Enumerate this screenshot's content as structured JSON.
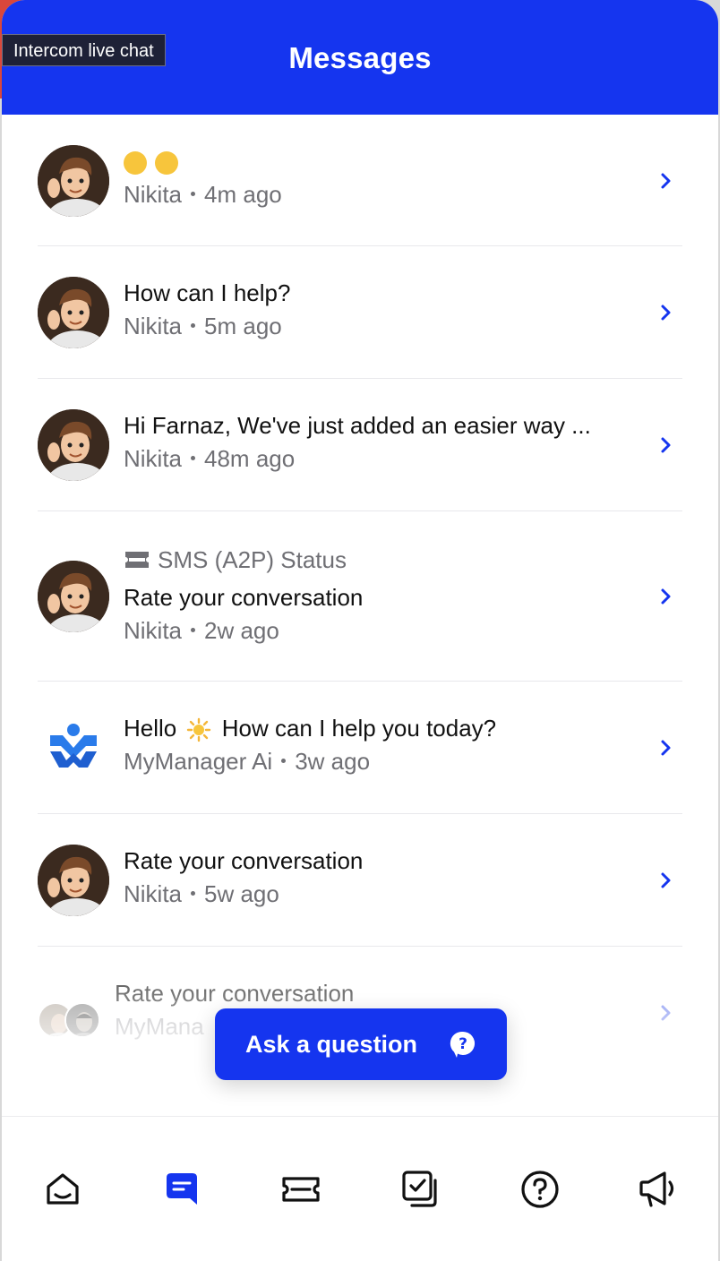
{
  "tooltip": "Intercom live chat",
  "header": {
    "title": "Messages"
  },
  "conversations": [
    {
      "title": "",
      "author": "Nikita",
      "time": "4m ago",
      "avatar": "nikita"
    },
    {
      "title": "How can I help?",
      "author": "Nikita",
      "time": "5m ago",
      "avatar": "nikita"
    },
    {
      "title": "Hi Farnaz, We've just added an easier way ...",
      "author": "Nikita",
      "time": "48m ago",
      "avatar": "nikita"
    },
    {
      "pre": "SMS (A2P) Status",
      "title": "Rate your conversation",
      "author": "Nikita",
      "time": "2w ago",
      "avatar": "nikita"
    },
    {
      "title_before": "Hello",
      "title_after": "How can I help you today?",
      "author": "MyManager Ai",
      "time": "3w ago",
      "avatar": "mymanager-logo"
    },
    {
      "title": "Rate your conversation",
      "author": "Nikita",
      "time": "5w ago",
      "avatar": "nikita"
    },
    {
      "title": "Rate your conversation",
      "author": "MyMana",
      "time": "",
      "avatar": "group"
    }
  ],
  "ask_button": {
    "label": "Ask a question"
  },
  "nav": [
    {
      "name": "home-icon"
    },
    {
      "name": "messages-icon",
      "active": true
    },
    {
      "name": "tickets-icon"
    },
    {
      "name": "tasks-icon"
    },
    {
      "name": "help-icon"
    },
    {
      "name": "news-icon"
    }
  ],
  "colors": {
    "brand": "#1535ef",
    "meta": "#6f6f74",
    "chevron": "#1535ef"
  }
}
